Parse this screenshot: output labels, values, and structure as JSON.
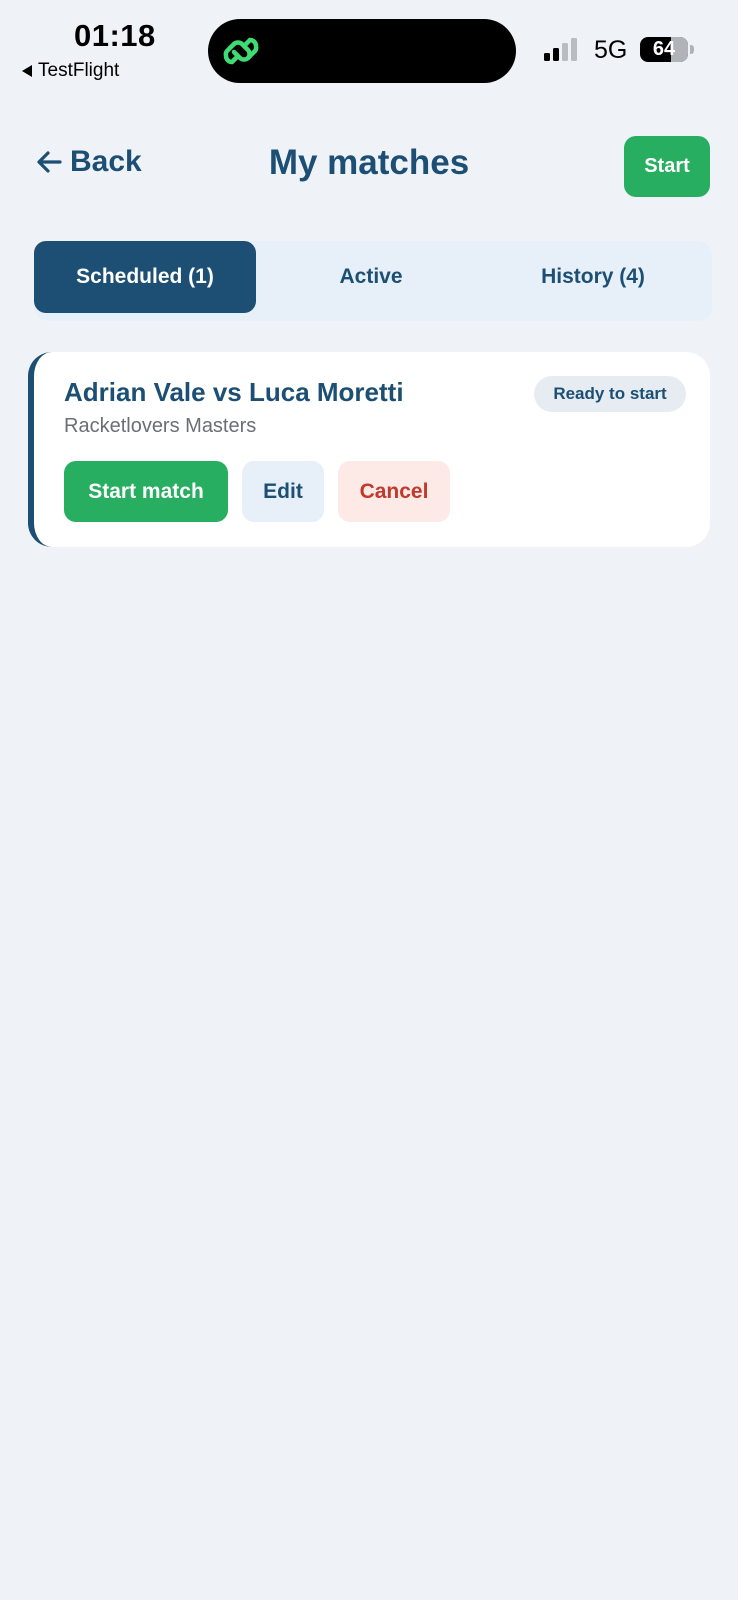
{
  "status_bar": {
    "time": "01:18",
    "back_app": "TestFlight",
    "network": "5G",
    "battery": "64",
    "battery_level": 0.64,
    "icons": [
      "back-triangle-icon",
      "linked-rings-icon",
      "signal-icon",
      "battery-icon"
    ]
  },
  "header": {
    "back_label": "Back",
    "title": "My matches",
    "start_label": "Start"
  },
  "tabs": [
    {
      "label": "Scheduled (1)",
      "active": true
    },
    {
      "label": "Active",
      "active": false
    },
    {
      "label": "History (4)",
      "active": false
    }
  ],
  "matches": [
    {
      "title": "Adrian Vale vs Luca Moretti",
      "tournament": "Racketlovers Masters",
      "status": "Ready to start",
      "actions": {
        "start": "Start match",
        "edit": "Edit",
        "cancel": "Cancel"
      }
    }
  ],
  "colors": {
    "background": "#eff3f8",
    "primary": "#1c4f73",
    "accent_green": "#27ae60",
    "danger": "#c0392b",
    "danger_bg": "#fde9e6",
    "tab_bg": "#e7f0f9"
  }
}
